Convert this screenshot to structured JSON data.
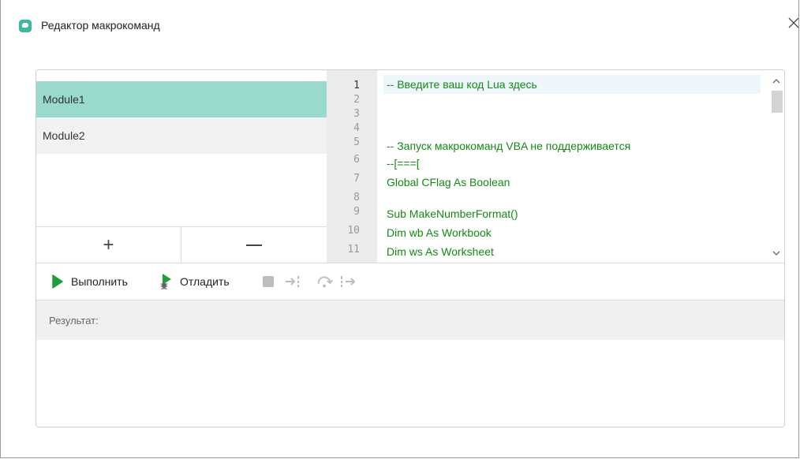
{
  "window": {
    "title": "Редактор макрокоманд",
    "close_icon": "close-icon"
  },
  "modules": {
    "items": [
      {
        "label": "Module1",
        "selected": true
      },
      {
        "label": "Module2",
        "selected": false
      }
    ],
    "add_label": "+",
    "remove_label": "—"
  },
  "editor": {
    "line_numbers": [
      "1",
      "2",
      "3",
      "4",
      "5",
      "6",
      "7",
      "8",
      "9",
      "10",
      "11"
    ],
    "lines": [
      "-- Введите ваш код Lua здесь",
      "",
      "",
      "",
      "-- Запуск макрокоманд VBA не поддерживается",
      "--[===[",
      "Global CFlag As Boolean",
      "",
      "Sub MakeNumberFormat()",
      "Dim wb As Workbook",
      "Dim ws As Worksheet"
    ],
    "code_color": "#138a13",
    "selection_color": "#99dacd"
  },
  "toolbar": {
    "run_label": "Выполнить",
    "debug_label": "Отладить",
    "run_icon": "play-icon",
    "debug_icon": "debug-bug-icon",
    "stop_icon": "stop-icon",
    "step_into_icon": "step-into-icon",
    "step_over_icon": "step-over-icon",
    "step_out_icon": "step-out-icon"
  },
  "result": {
    "label": "Результат:",
    "value": ""
  }
}
